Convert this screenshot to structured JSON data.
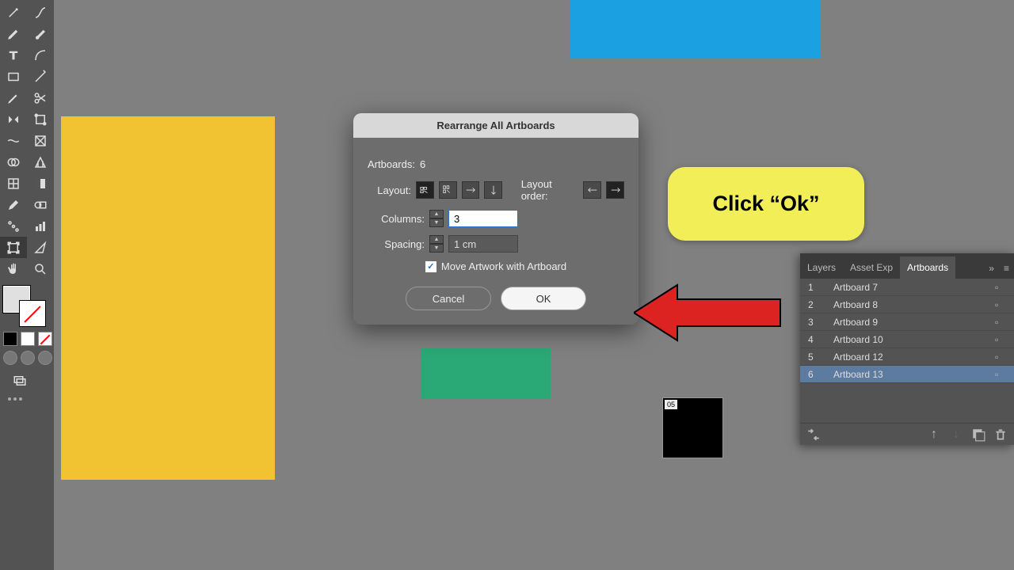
{
  "dialog": {
    "title": "Rearrange All Artboards",
    "artboards_label": "Artboards:",
    "artboards_count": "6",
    "layout_label": "Layout:",
    "order_label": "Layout order:",
    "columns_label": "Columns:",
    "columns_value": "3",
    "spacing_label": "Spacing:",
    "spacing_value": "1 cm",
    "move_label": "Move Artwork with Artboard",
    "cancel": "Cancel",
    "ok": "OK"
  },
  "callout": {
    "text": "Click “Ok”"
  },
  "black_box_label": "05",
  "panel": {
    "tabs": {
      "layers": "Layers",
      "asset": "Asset Exp",
      "artboards": "Artboards"
    },
    "rows": [
      {
        "num": "1",
        "name": "Artboard 7"
      },
      {
        "num": "2",
        "name": "Artboard 8"
      },
      {
        "num": "3",
        "name": "Artboard 9"
      },
      {
        "num": "4",
        "name": "Artboard 10"
      },
      {
        "num": "5",
        "name": "Artboard 12"
      },
      {
        "num": "6",
        "name": "Artboard 13"
      }
    ]
  }
}
